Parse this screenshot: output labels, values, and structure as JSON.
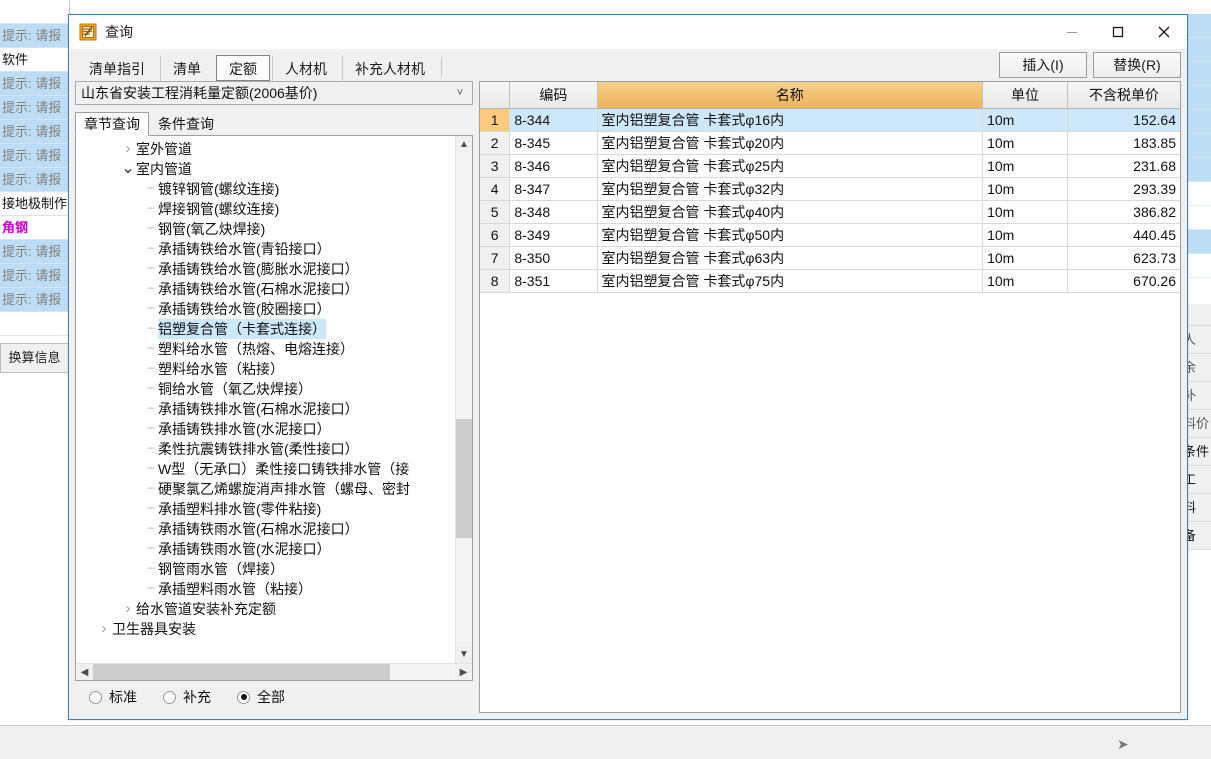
{
  "background": {
    "left_rows": [
      {
        "text": "提示: 请报",
        "style": "hl"
      },
      {
        "text": "软件",
        "style": "white dark"
      },
      {
        "text": "提示: 请报",
        "style": "hl"
      },
      {
        "text": "提示: 请报",
        "style": "hl"
      },
      {
        "text": "提示: 请报",
        "style": "hl"
      },
      {
        "text": "提示: 请报",
        "style": "hl"
      },
      {
        "text": "提示: 请报",
        "style": "hl"
      },
      {
        "text": "接地极制作",
        "style": "white dark"
      },
      {
        "text": "角钢",
        "style": "magenta"
      },
      {
        "text": "提示: 请报",
        "style": "hl"
      },
      {
        "text": "提示: 请报",
        "style": "hl"
      },
      {
        "text": "提示: 请报",
        "style": "hl"
      }
    ],
    "tab_button": "换算信息",
    "right_vtabs": [
      "人",
      "余",
      "补",
      "料价",
      "条件",
      "工",
      "料",
      "备"
    ]
  },
  "dialog": {
    "icon": "query-document-icon",
    "title": "查询",
    "window_buttons": {
      "minimize": "minimize-icon",
      "maximize": "maximize-icon",
      "close": "close-icon"
    },
    "tabs": [
      {
        "label": "清单指引",
        "active": false
      },
      {
        "label": "清单",
        "active": false
      },
      {
        "label": "定额",
        "active": true
      },
      {
        "label": "人材机",
        "active": false
      },
      {
        "label": "补充人材机",
        "active": false
      }
    ],
    "actions": [
      {
        "label": "插入(I)",
        "name": "insert-button"
      },
      {
        "label": "替换(R)",
        "name": "replace-button"
      }
    ],
    "library_combo": {
      "value": "山东省安装工程消耗量定额(2006基价)",
      "arrow": "chevron-down-icon"
    },
    "sub_tabs": [
      {
        "label": "章节查询",
        "active": true
      },
      {
        "label": "条件查询",
        "active": false
      }
    ],
    "tree": [
      {
        "label": "室外管道",
        "level": 1,
        "type": "collapsed",
        "selected": false
      },
      {
        "label": "室内管道",
        "level": 1,
        "type": "expanded",
        "selected": false
      },
      {
        "label": "镀锌钢管(螺纹连接)",
        "level": 2,
        "type": "leaf",
        "selected": false
      },
      {
        "label": "焊接钢管(螺纹连接)",
        "level": 2,
        "type": "leaf",
        "selected": false
      },
      {
        "label": "钢管(氧乙炔焊接)",
        "level": 2,
        "type": "leaf",
        "selected": false
      },
      {
        "label": "承插铸铁给水管(青铅接口）",
        "level": 2,
        "type": "leaf",
        "selected": false
      },
      {
        "label": "承插铸铁给水管(膨胀水泥接口）",
        "level": 2,
        "type": "leaf",
        "selected": false
      },
      {
        "label": "承插铸铁给水管(石棉水泥接口）",
        "level": 2,
        "type": "leaf",
        "selected": false
      },
      {
        "label": "承插铸铁给水管(胶圈接口）",
        "level": 2,
        "type": "leaf",
        "selected": false
      },
      {
        "label": "铝塑复合管（卡套式连接）",
        "level": 2,
        "type": "leaf",
        "selected": true
      },
      {
        "label": "塑料给水管（热熔、电熔连接）",
        "level": 2,
        "type": "leaf",
        "selected": false
      },
      {
        "label": "塑料给水管（粘接）",
        "level": 2,
        "type": "leaf",
        "selected": false
      },
      {
        "label": "铜给水管（氧乙炔焊接）",
        "level": 2,
        "type": "leaf",
        "selected": false
      },
      {
        "label": "承插铸铁排水管(石棉水泥接口）",
        "level": 2,
        "type": "leaf",
        "selected": false
      },
      {
        "label": "承插铸铁排水管(水泥接口）",
        "level": 2,
        "type": "leaf",
        "selected": false
      },
      {
        "label": "柔性抗震铸铁排水管(柔性接口）",
        "level": 2,
        "type": "leaf",
        "selected": false
      },
      {
        "label": "W型（无承口）柔性接口铸铁排水管（接",
        "level": 2,
        "type": "leaf",
        "selected": false
      },
      {
        "label": "硬聚氯乙烯螺旋消声排水管（螺母、密封",
        "level": 2,
        "type": "leaf",
        "selected": false
      },
      {
        "label": "承插塑料排水管(零件粘接)",
        "level": 2,
        "type": "leaf",
        "selected": false
      },
      {
        "label": "承插铸铁雨水管(石棉水泥接口）",
        "level": 2,
        "type": "leaf",
        "selected": false
      },
      {
        "label": "承插铸铁雨水管(水泥接口）",
        "level": 2,
        "type": "leaf",
        "selected": false
      },
      {
        "label": "钢管雨水管（焊接）",
        "level": 2,
        "type": "leaf",
        "selected": false
      },
      {
        "label": "承插塑料雨水管（粘接）",
        "level": 2,
        "type": "leaf",
        "selected": false
      },
      {
        "label": "给水管道安装补充定额",
        "level": 1,
        "type": "collapsed",
        "selected": false
      },
      {
        "label": "卫生器具安装",
        "level": 0,
        "type": "collapsed",
        "selected": false
      }
    ],
    "filter_radios": [
      {
        "label": "标准",
        "checked": false
      },
      {
        "label": "补充",
        "checked": false
      },
      {
        "label": "全部",
        "checked": true
      }
    ],
    "grid": {
      "columns": [
        "",
        "编码",
        "名称",
        "单位",
        "不含税单价"
      ],
      "rows": [
        {
          "no": "1",
          "code": "8-344",
          "name": "室内铝塑复合管 卡套式φ16内",
          "unit": "10m",
          "price": "152.64",
          "selected": true
        },
        {
          "no": "2",
          "code": "8-345",
          "name": "室内铝塑复合管 卡套式φ20内",
          "unit": "10m",
          "price": "183.85",
          "selected": false
        },
        {
          "no": "3",
          "code": "8-346",
          "name": "室内铝塑复合管 卡套式φ25内",
          "unit": "10m",
          "price": "231.68",
          "selected": false
        },
        {
          "no": "4",
          "code": "8-347",
          "name": "室内铝塑复合管 卡套式φ32内",
          "unit": "10m",
          "price": "293.39",
          "selected": false
        },
        {
          "no": "5",
          "code": "8-348",
          "name": "室内铝塑复合管 卡套式φ40内",
          "unit": "10m",
          "price": "386.82",
          "selected": false
        },
        {
          "no": "6",
          "code": "8-349",
          "name": "室内铝塑复合管 卡套式φ50内",
          "unit": "10m",
          "price": "440.45",
          "selected": false
        },
        {
          "no": "7",
          "code": "8-350",
          "name": "室内铝塑复合管 卡套式φ63内",
          "unit": "10m",
          "price": "623.73",
          "selected": false
        },
        {
          "no": "8",
          "code": "8-351",
          "name": "室内铝塑复合管 卡套式φ75内",
          "unit": "10m",
          "price": "670.26",
          "selected": false
        }
      ]
    }
  },
  "colors": {
    "dialog_border": "#3f7fbf",
    "name_header": "#eeb45a",
    "selection": "#cde8fb",
    "row_number_selected": "#fbc97f",
    "bg_highlight": "#bcddf4",
    "magenta_text": "#cc00cc"
  }
}
